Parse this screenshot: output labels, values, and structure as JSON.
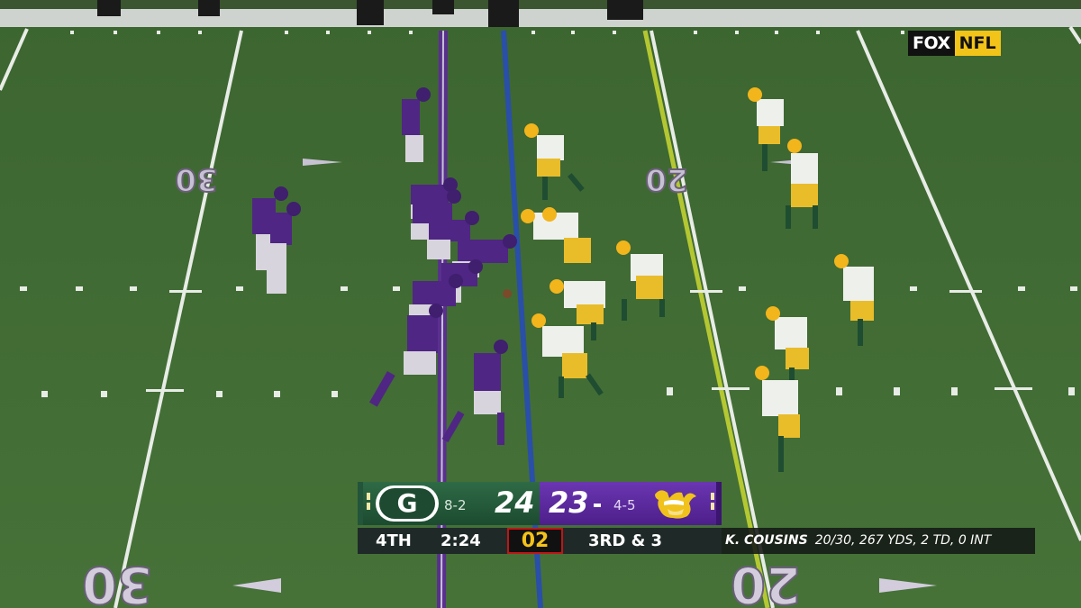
{
  "broadcast": {
    "network": "FOX",
    "league": "NFL"
  },
  "field": {
    "yard_numbers": [
      "30",
      "20",
      "20",
      "30"
    ],
    "colors": {
      "turf": "#3f6a33",
      "los_line": "#2a4fa8",
      "first_down_line": "#c9d832",
      "vikings_purple": "#4f2683"
    }
  },
  "scorebug": {
    "away": {
      "team": "Packers",
      "logo_icon": "packers-g-logo",
      "logo_letter": "G",
      "record": "8-2",
      "score": "24",
      "color": "#1c4b30"
    },
    "home": {
      "team": "Vikings",
      "logo_icon": "vikings-head-logo",
      "record": "4-5",
      "score": "23",
      "color": "#4f2683"
    },
    "quarter": "4TH",
    "game_clock": "2:24",
    "play_clock": "02",
    "down_distance": "3RD & 3"
  },
  "stat_ticker": {
    "player": "K. COUSINS",
    "line": "20/30, 267 YDS, 2 TD, 0 INT"
  }
}
